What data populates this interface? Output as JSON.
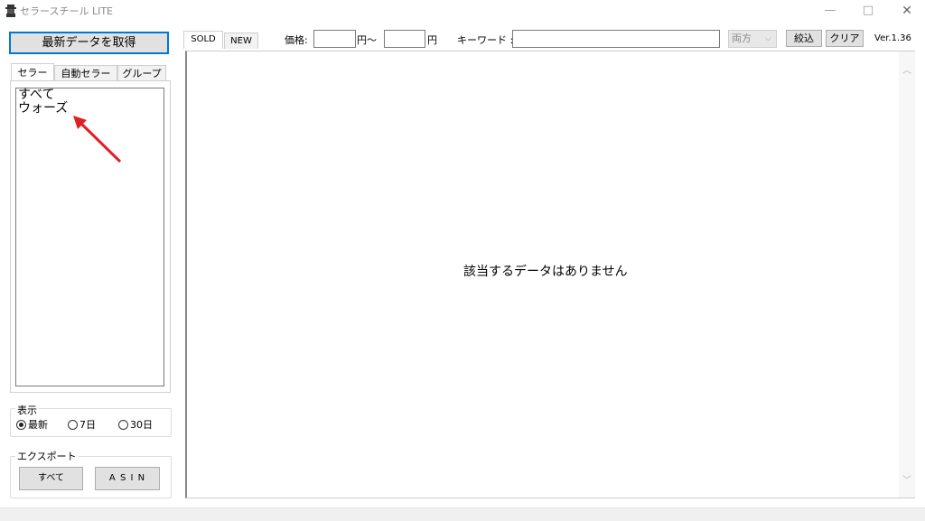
{
  "window": {
    "title": "セラースチール LITE",
    "controls": {
      "minimize": "—",
      "maximize": "□",
      "close": "✕"
    }
  },
  "left": {
    "fetch_button": "最新データを取得",
    "tabs": [
      {
        "label": "セラー",
        "active": true
      },
      {
        "label": "自動セラー",
        "active": false
      },
      {
        "label": "グループ",
        "active": false
      }
    ],
    "seller_list": [
      "すべて",
      "ウォーズ"
    ],
    "display": {
      "label": "表示",
      "options": [
        {
          "label": "最新",
          "checked": true
        },
        {
          "label": "7日",
          "checked": false
        },
        {
          "label": "30日",
          "checked": false
        }
      ]
    },
    "export": {
      "label": "エクスポート",
      "all_button": "すべて",
      "asin_button": "A S I N"
    }
  },
  "toolbar": {
    "tabs": [
      {
        "label": "SOLD",
        "active": true
      },
      {
        "label": "NEW",
        "active": false
      }
    ],
    "price_label": "価格:",
    "price_min": "",
    "yen_from": "円〜",
    "price_max": "",
    "yen": "円",
    "keyword_label": "キーワード :",
    "keyword_value": "",
    "mode_select": "両方",
    "filter_button": "絞込",
    "clear_button": "クリア",
    "version": "Ver.1.36"
  },
  "main": {
    "empty_message": "該当するデータはありません"
  },
  "annotation": {
    "color": "#e02020"
  }
}
